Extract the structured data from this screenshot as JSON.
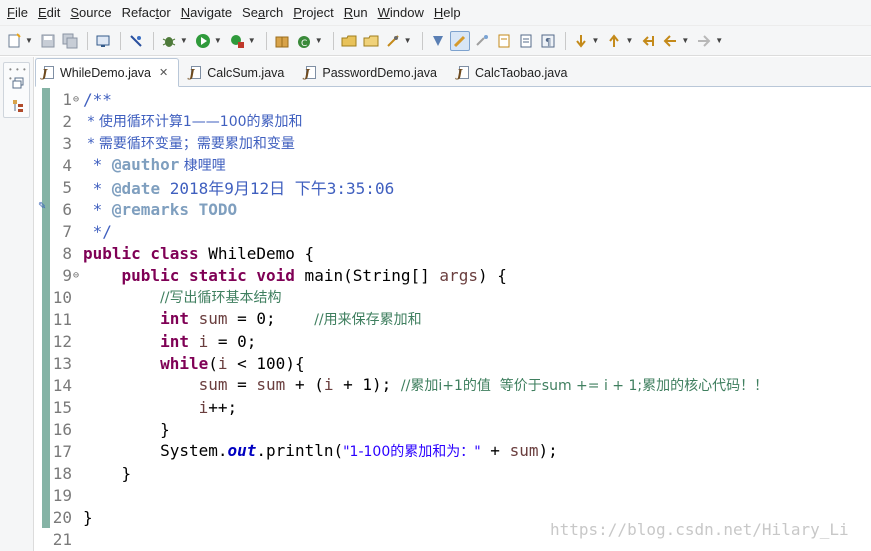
{
  "menu": [
    "File",
    "Edit",
    "Source",
    "Refactor",
    "Navigate",
    "Search",
    "Project",
    "Run",
    "Window",
    "Help"
  ],
  "menu_mnemonics": [
    "F",
    "E",
    "S",
    "t",
    "N",
    "a",
    "P",
    "R",
    "W",
    "H"
  ],
  "toolbar_icons": [
    "new-icon",
    "save-icon",
    "save-all-icon",
    "console-icon",
    "skip-breakpoints-icon",
    "debug-icon",
    "run-icon",
    "run-external-tool-icon",
    "new-java-package-icon",
    "new-java-class-icon",
    "open-type-icon",
    "open-task-icon",
    "search-icon",
    "toggle-mark-occurrences-icon",
    "toggle-word-wrap-icon",
    "block-selection-icon",
    "show-whitespace-icon",
    "next-annotation-icon",
    "previous-annotation-icon",
    "last-edit-location-icon",
    "back-icon",
    "forward-icon"
  ],
  "tabs": [
    {
      "label": "WhileDemo.java",
      "active": true,
      "closable": true
    },
    {
      "label": "CalcSum.java",
      "active": false
    },
    {
      "label": "PasswordDemo.java",
      "active": false
    },
    {
      "label": "CalcTaobao.java",
      "active": false
    }
  ],
  "line_numbers": [
    "1",
    "2",
    "3",
    "4",
    "5",
    "6",
    "7",
    "8",
    "9",
    "10",
    "11",
    "12",
    "13",
    "14",
    "15",
    "16",
    "17",
    "18",
    "19",
    "20",
    "21"
  ],
  "code": {
    "l1": "/**",
    "l2": " * 使用循环计算1——100的累加和",
    "l3": " * 需要循环变量；需要累加和变量",
    "l4_star": " * ",
    "l4_tag": "@author",
    "l4_text": " 棣哩哩",
    "l5_star": " * ",
    "l5_tag": "@date",
    "l5_text": " 2018年9月12日 下午3:35:06",
    "l6_star": " * ",
    "l6_tag": "@remarks",
    "l6_text": " TODO",
    "l7": " */",
    "l8_kw": "public class",
    "l8_rest": " WhileDemo {",
    "l9_indent": "    ",
    "l9_kw": "public static void",
    "l9_rest1": " main(String[] ",
    "l9_var": "args",
    "l9_rest2": ") {",
    "l10_indent": "        ",
    "l10_cmt": "//写出循环基本结构",
    "l11_indent": "        ",
    "l11_kw": "int",
    "l11_sp": " ",
    "l11_var": "sum",
    "l11_rest": " = 0;    ",
    "l11_cmt": "//用来保存累加和",
    "l12_indent": "        ",
    "l12_kw": "int",
    "l12_sp": " ",
    "l12_var": "i",
    "l12_rest": " = 0;",
    "l13_indent": "        ",
    "l13_kw": "while",
    "l13_p1": "(",
    "l13_var": "i",
    "l13_rest": " < 100){",
    "l14_indent": "            ",
    "l14_v1": "sum",
    "l14_op1": " = ",
    "l14_v2": "sum",
    "l14_op2": " + (",
    "l14_v3": "i",
    "l14_op3": " + 1); ",
    "l14_cmt": "//累加i+1的值  等价于sum += i + 1;累加的核心代码！！",
    "l15_indent": "            ",
    "l15_var": "i",
    "l15_rest": "++;",
    "l16": "        }",
    "l17_indent": "        ",
    "l17_a": "System.",
    "l17_fld": "out",
    "l17_b": ".println(",
    "l17_str": "\"1-100的累加和为：\"",
    "l17_c": " + ",
    "l17_var": "sum",
    "l17_d": ");",
    "l18": "    }",
    "l19": "",
    "l20": "}",
    "l21": ""
  },
  "watermark": "https://blog.csdn.net/Hilary_Li"
}
